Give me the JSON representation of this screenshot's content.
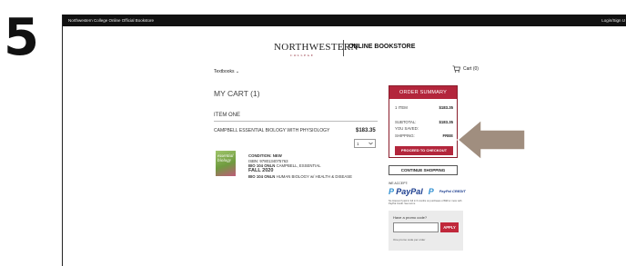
{
  "step_number": "5",
  "topbar": {
    "site_title": "Northwestern College Online Official Bookstore",
    "login": "Login/Sign U"
  },
  "logo": {
    "name": "NORTHWESTERN",
    "subtitle": "COLLEGE",
    "store": "ONLINE BOOKSTORE"
  },
  "nav": {
    "textbooks": "Textbooks ⌄",
    "cart": "Cart (0)"
  },
  "cart": {
    "title": "MY CART (1)",
    "item_heading": "ITEM ONE",
    "item_title": "CAMPBELL ESSENTIAL BIOLOGY WITH PHYSIOLOGY",
    "item_price": "$183.35",
    "quantity": "1",
    "book_cover_text": "essential biology",
    "condition_label": "CONDITION: NEW",
    "isbn": "ISBN: 9780134075763",
    "course_line1_code": "BIO 104 ONLN",
    "course_line1_extra": "CAMPBELL, ESSENTIAL",
    "course_term": "FALL 2020",
    "course_line2_code": "BIO 104 ONLN",
    "course_line2_name": "HUMAN BIOLOGY w/ HEALTH & DISEASE"
  },
  "summary": {
    "heading": "ORDER SUMMARY",
    "items_label": "1 ITEM",
    "items_value": "$183.35",
    "subtotal_label": "SUBTOTAL:",
    "subtotal_value": "$183.35",
    "saved_label": "YOU SAVED:",
    "shipping_label": "SHIPPING:",
    "shipping_value": "FREE",
    "checkout_button": "PROCEED TO CHECKOUT"
  },
  "continue_button": "CONTINUE SHOPPING",
  "payments": {
    "accept_label": "WE ACCEPT:",
    "paypal": "PayPal",
    "paypal_credit": "PayPal CREDIT",
    "fine_print": "No Interest if paid in full in 6 months on purchases of $99 or more with PayPal Credit. See terms."
  },
  "promo": {
    "question": "Have a promo code?",
    "apply_button": "APPLY",
    "note": "One promo code per order"
  },
  "colors": {
    "brand": "#b3263c",
    "arrow": "#a08e7f"
  }
}
